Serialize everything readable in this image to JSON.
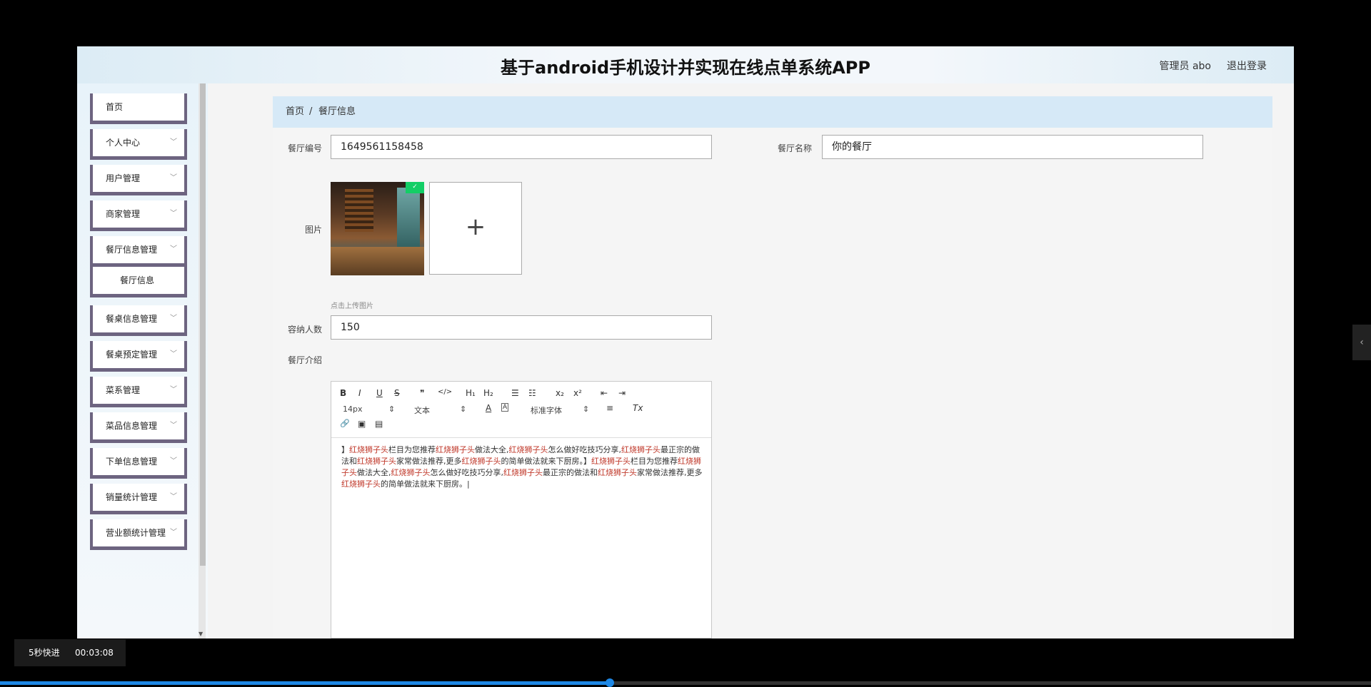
{
  "header": {
    "title": "基于android手机设计并实现在线点单系统APP",
    "user": "管理员 abo",
    "logout": "退出登录"
  },
  "sidebar": {
    "items": [
      {
        "label": "首页",
        "chevron": ""
      },
      {
        "label": "个人中心",
        "chevron": "﹀"
      },
      {
        "label": "用户管理",
        "chevron": "﹀"
      },
      {
        "label": "商家管理",
        "chevron": "﹀"
      },
      {
        "label": "餐厅信息管理",
        "chevron": "﹀"
      },
      {
        "label": "餐厅信息",
        "chevron": ""
      },
      {
        "label": "餐桌信息管理",
        "chevron": "﹀"
      },
      {
        "label": "餐桌预定管理",
        "chevron": "﹀"
      },
      {
        "label": "菜系管理",
        "chevron": "﹀"
      },
      {
        "label": "菜品信息管理",
        "chevron": "﹀"
      },
      {
        "label": "下单信息管理",
        "chevron": "﹀"
      },
      {
        "label": "销量统计管理",
        "chevron": "﹀"
      },
      {
        "label": "营业额统计管理",
        "chevron": "﹀"
      }
    ]
  },
  "breadcrumb": {
    "home": "首页",
    "separator": "/",
    "current": "餐厅信息"
  },
  "form": {
    "restaurant_no_label": "餐厅编号",
    "restaurant_no_value": "1649561158458",
    "restaurant_name_label": "餐厅名称",
    "restaurant_name_value": "你的餐厅",
    "image_label": "图片",
    "upload_plus": "+",
    "upload_tip": "点击上传图片",
    "capacity_label": "容纳人数",
    "capacity_value": "150",
    "intro_label": "餐厅介绍"
  },
  "editor": {
    "toolbar": {
      "bold": "B",
      "italic": "I",
      "underline": "U",
      "strike": "S",
      "quote": "❞",
      "code": "</>",
      "h1": "H₁",
      "h2": "H₂",
      "ordered_list": "☰",
      "bullet_list": "☷",
      "subscript": "x₂",
      "superscript": "x²",
      "outdent": "⇤",
      "indent": "⇥",
      "font_size": "14px",
      "font_size_arrow": "⇕",
      "paragraph": "文本",
      "paragraph_arrow": "⇕",
      "font_color": "A",
      "bg_color": "A",
      "font_family": "标准字体",
      "font_family_arrow": "⇕",
      "align": "≡",
      "clean": "Tx",
      "link": "🔗",
      "image": "▣",
      "video": "▤"
    },
    "content": [
      {
        "t": "】",
        "h": false
      },
      {
        "t": "红烧狮子头",
        "h": true
      },
      {
        "t": "栏目为您推荐",
        "h": false
      },
      {
        "t": "红烧狮子头",
        "h": true
      },
      {
        "t": "做法大全,",
        "h": false
      },
      {
        "t": "红烧狮子头",
        "h": true
      },
      {
        "t": "怎么做好吃技巧分享,",
        "h": false
      },
      {
        "t": "红烧狮子头",
        "h": true
      },
      {
        "t": "最正宗的做法和",
        "h": false
      },
      {
        "t": "红烧狮子头",
        "h": true
      },
      {
        "t": "家常做法推荐,更多",
        "h": false
      },
      {
        "t": "红烧狮子头",
        "h": true
      },
      {
        "t": "的简单做法就来下厨房。】",
        "h": false
      },
      {
        "t": "红烧狮子头",
        "h": true
      },
      {
        "t": "栏目为您推荐",
        "h": false
      },
      {
        "t": "红烧狮子头",
        "h": true
      },
      {
        "t": "做法大全,",
        "h": false
      },
      {
        "t": "红烧狮子头",
        "h": true
      },
      {
        "t": "怎么做好吃技巧分享,",
        "h": false
      },
      {
        "t": "红烧狮子头",
        "h": true
      },
      {
        "t": "最正宗的做法和",
        "h": false
      },
      {
        "t": "红烧狮子头",
        "h": true
      },
      {
        "t": "家常做法推荐,更多",
        "h": false
      },
      {
        "t": "红烧狮子头",
        "h": true
      },
      {
        "t": "的简单做法就来下厨房。|",
        "h": false
      }
    ]
  },
  "player": {
    "speed_label": "5秒快进",
    "time": "00:03:08",
    "side_handle": "‹"
  }
}
